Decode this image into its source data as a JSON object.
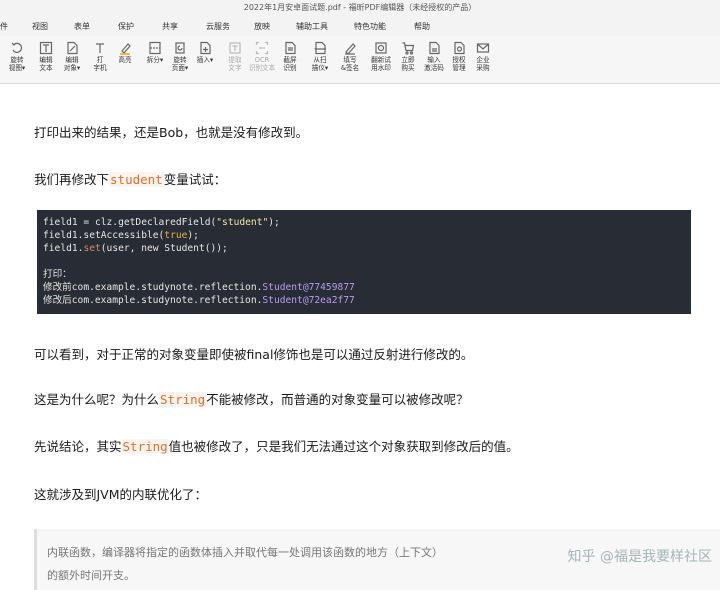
{
  "window": {
    "title": "2022年1月安卓面试题.pdf - 福昕PDF编辑器（未经授权的产品）"
  },
  "menu": [
    "件",
    "视图",
    "表单",
    "保护",
    "共享",
    "云服务",
    "放映",
    "辅助工具",
    "特色功能",
    "帮助"
  ],
  "toolbar": [
    {
      "label": "旋转\n视图▾",
      "icon": "rotate-icon",
      "enabled": true
    },
    {
      "label": "编辑\n文本",
      "icon": "edit-text-icon",
      "enabled": true
    },
    {
      "label": "编辑\n对象▾",
      "icon": "edit-object-icon",
      "enabled": true
    },
    {
      "label": "打\n字机",
      "icon": "typewriter-icon",
      "enabled": true
    },
    {
      "label": "高亮",
      "icon": "highlight-icon",
      "enabled": true
    },
    {
      "label": "拆分▾",
      "icon": "split-icon",
      "enabled": true
    },
    {
      "label": "旋转\n页面▾",
      "icon": "rotate-page-icon",
      "enabled": true
    },
    {
      "label": "插入▾",
      "icon": "insert-icon",
      "enabled": true
    },
    {
      "label": "提取\n文字",
      "icon": "extract-text-icon",
      "enabled": false
    },
    {
      "label": "OCR\n识别文本",
      "icon": "ocr-icon",
      "enabled": false
    },
    {
      "label": "截屏\n识别",
      "icon": "screenshot-ocr-icon",
      "enabled": true
    },
    {
      "label": "从扫\n描仪▾",
      "icon": "scanner-icon",
      "enabled": true
    },
    {
      "label": "填写\n&签名",
      "icon": "sign-icon",
      "enabled": true
    },
    {
      "label": "翻新试\n用水印",
      "icon": "watermark-icon",
      "enabled": true
    },
    {
      "label": "立即\n购买",
      "icon": "cart-icon",
      "enabled": true
    },
    {
      "label": "输入\n激活码",
      "icon": "activation-code-icon",
      "enabled": true
    },
    {
      "label": "授权\n管理",
      "icon": "license-icon",
      "enabled": true
    },
    {
      "label": "企业\n采购",
      "icon": "mail-icon",
      "enabled": true
    }
  ],
  "doc": {
    "p1": "打印出来的结果，还是Bob，也就是没有修改到。",
    "p2_pre": "我们再修改下",
    "p2_hl": "student",
    "p2_post": "变量试试：",
    "code": {
      "l1_a": "field1 = clz.getDeclaredField(",
      "l1_str": "\"student\"",
      "l1_b": ");",
      "l2_a": "field1.setAccessible(",
      "l2_kw": "true",
      "l2_b": ");",
      "l3_a": "field1.",
      "l3_fn": "set",
      "l3_b": "(user, new Student());",
      "l5": "打印：",
      "l6_a": "修改前com.example.studynote.reflection.",
      "l6_p": "Student@77459877",
      "l7_a": "修改后com.example.studynote.reflection.",
      "l7_p": "Student@72ea2f77"
    },
    "p3": "可以看到，对于正常的对象变量即使被final修饰也是可以通过反射进行修改的。",
    "p4_pre": "这是为什么呢？为什么",
    "p4_hl": "String",
    "p4_post": "不能被修改，而普通的对象变量可以被修改呢？",
    "p5_pre": "先说结论，其实",
    "p5_hl": "String",
    "p5_post": "值也被修改了，只是我们无法通过这个对象获取到修改后的值。",
    "p6": "这就涉及到JVM的内联优化了：",
    "quote_l1": "内联函数，编译器将指定的函数体插入并取代每一处调用该函数的地方（上下文）",
    "quote_l2": "的额外时间开支。",
    "watermark": "知乎 @福是我要样社区"
  }
}
